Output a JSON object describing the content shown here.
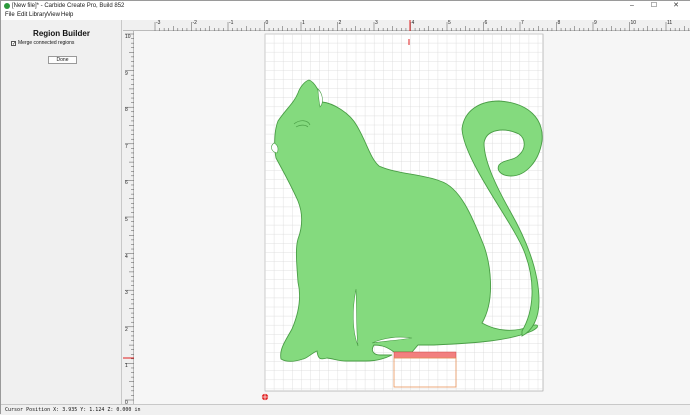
{
  "window": {
    "title": "[New file]* - Carbide Create Pro, Build 852",
    "controls": [
      "–",
      "☐",
      "✕"
    ]
  },
  "menu": [
    "File",
    "Edit",
    "Library",
    "View",
    "Help"
  ],
  "panel": {
    "title": "Region Builder",
    "merge_label": "Merge connected regions",
    "merge_checked": true,
    "check_glyph": "✓",
    "done_label": "Done"
  },
  "rulers": {
    "top_labels": [
      "-3",
      "-2",
      "-1",
      "0",
      "1",
      "2",
      "3",
      "4",
      "5",
      "6",
      "7",
      "8",
      "9",
      "10",
      "11"
    ],
    "left_labels": [
      "10",
      "9",
      "8",
      "7",
      "6",
      "5",
      "4",
      "3",
      "2",
      "1",
      "0"
    ]
  },
  "icons": {
    "app": "carbide-create-icon",
    "origin": "origin-marker-icon"
  },
  "colors": {
    "region_fill": "#84da7e",
    "region_stroke": "#4a9e46",
    "selection_fill": "#f27f7f",
    "cursor_marker": "#e02020",
    "box_outline": "#e8935a"
  },
  "status": {
    "cursor": "Cursor Position X: 3.935 Y: 1.124 Z: 0.000 in"
  }
}
